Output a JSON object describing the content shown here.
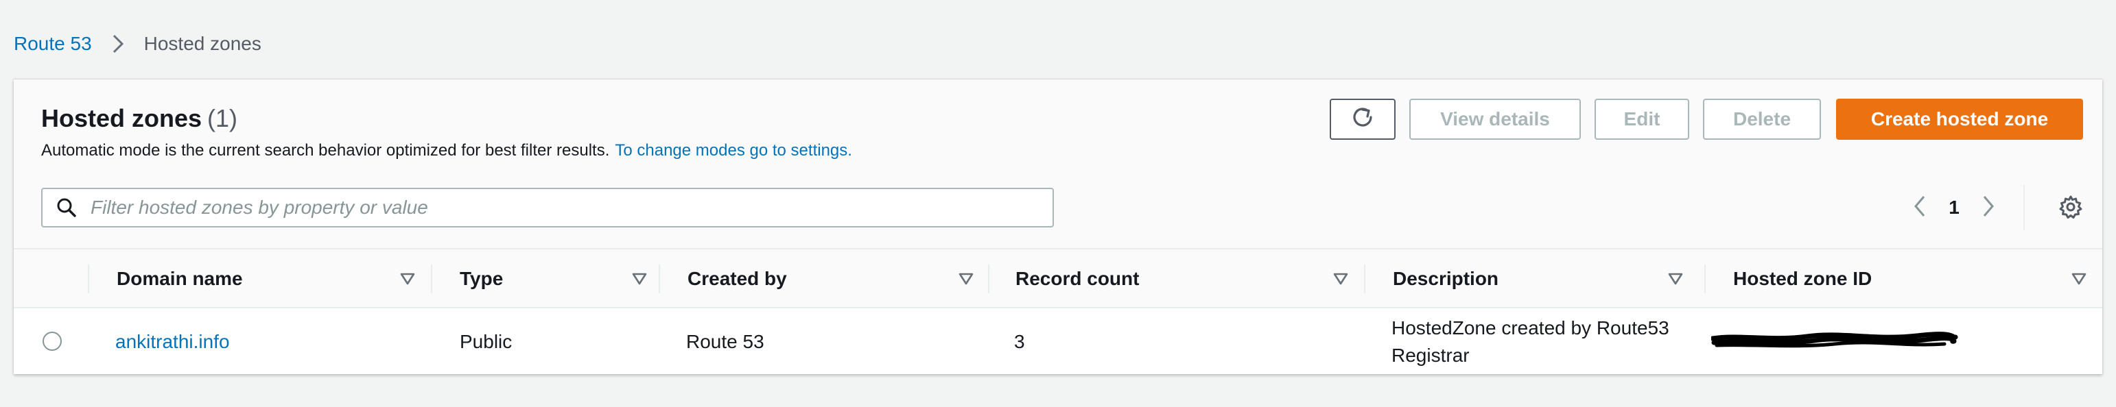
{
  "breadcrumb": {
    "root": "Route 53",
    "current": "Hosted zones"
  },
  "header": {
    "title": "Hosted zones",
    "count": "(1)",
    "subtitle": "Automatic mode is the current search behavior optimized for best filter results.",
    "subtitle_link": "To change modes go to settings."
  },
  "actions": {
    "refresh_icon": "refresh-icon",
    "view_details": "View details",
    "edit": "Edit",
    "delete": "Delete",
    "create": "Create hosted zone"
  },
  "search": {
    "placeholder": "Filter hosted zones by property or value",
    "value": ""
  },
  "pagination": {
    "current_page": "1"
  },
  "table": {
    "columns": [
      "Domain name",
      "Type",
      "Created by",
      "Record count",
      "Description",
      "Hosted zone ID"
    ],
    "rows": [
      {
        "domain_name": "ankitrathi.info",
        "type": "Public",
        "created_by": "Route 53",
        "record_count": "3",
        "description": "HostedZone created by Route53 Registrar",
        "hosted_zone_id": ""
      }
    ]
  },
  "colors": {
    "primary_link": "#0073bb",
    "primary_button": "#ec7211",
    "disabled": "#aab7b8",
    "text": "#16191f",
    "background": "#f2f3f3"
  }
}
